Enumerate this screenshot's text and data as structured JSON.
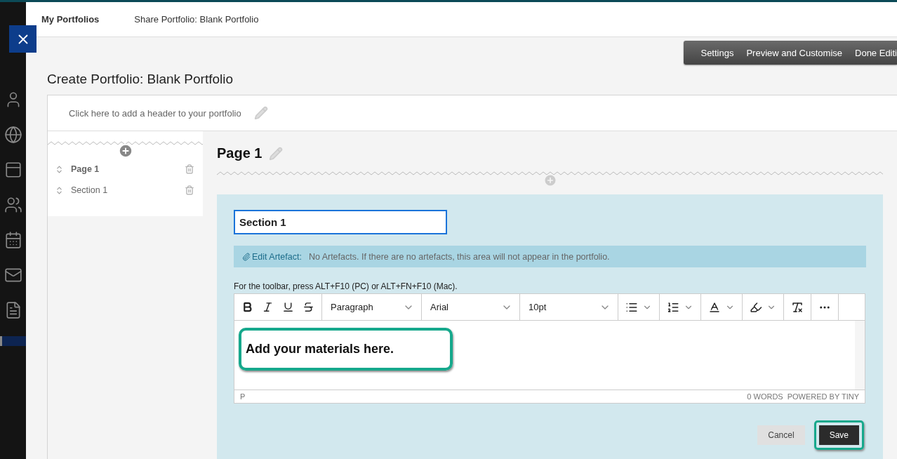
{
  "rail": {
    "items": [
      {
        "kind": "person"
      },
      {
        "kind": "globe"
      },
      {
        "kind": "panel"
      },
      {
        "kind": "group"
      },
      {
        "kind": "calendar"
      },
      {
        "kind": "mail"
      },
      {
        "kind": "notes"
      },
      {
        "kind": "blank",
        "selected": true
      }
    ]
  },
  "header_tabs": [
    {
      "label": "My Portfolios",
      "selected": true
    },
    {
      "label": "Share Portfolio: Blank Portfolio",
      "selected": false
    }
  ],
  "toolbar": [
    "Settings",
    "Preview and Customise",
    "Done Editi"
  ],
  "title": "Create Portfolio: Blank Portfolio",
  "header_prompt": "Click here to add a header to your portfolio",
  "outline": [
    {
      "label": "Page 1",
      "kind": "page"
    },
    {
      "label": "Section 1",
      "kind": "section"
    }
  ],
  "page_title": "Page 1",
  "section": {
    "title_value": "Section 1",
    "artefact_link": "Edit Artefact:",
    "artefact_note": "No Artefacts. If there are no artefacts, this area will not appear in the portfolio.",
    "toolbar_hint": "For the toolbar, press ALT+F10 (PC) or ALT+FN+F10 (Mac).",
    "editor": {
      "format_tools": [
        {
          "kind": "bold"
        },
        {
          "kind": "italic"
        },
        {
          "kind": "underline"
        },
        {
          "kind": "strike"
        }
      ],
      "dropdowns": [
        "Paragraph",
        "Arial",
        "10pt"
      ],
      "tools": [
        {
          "kind": "bullets",
          "menu": true
        },
        {
          "kind": "numbers",
          "menu": true
        },
        {
          "kind": "text-color",
          "menu": true
        },
        {
          "kind": "highlight",
          "menu": true
        },
        {
          "kind": "clear-format",
          "menu": false
        },
        {
          "kind": "more",
          "menu": false
        }
      ],
      "content": "Add your materials here.",
      "content_highlighted": true,
      "path": "P",
      "word_count": "0 WORDS",
      "branding": "POWERED BY TINY"
    },
    "buttons": [
      {
        "label": "Cancel",
        "kind": "secondary",
        "highlighted": false
      },
      {
        "label": "Save",
        "kind": "primary",
        "highlighted": true
      }
    ]
  }
}
